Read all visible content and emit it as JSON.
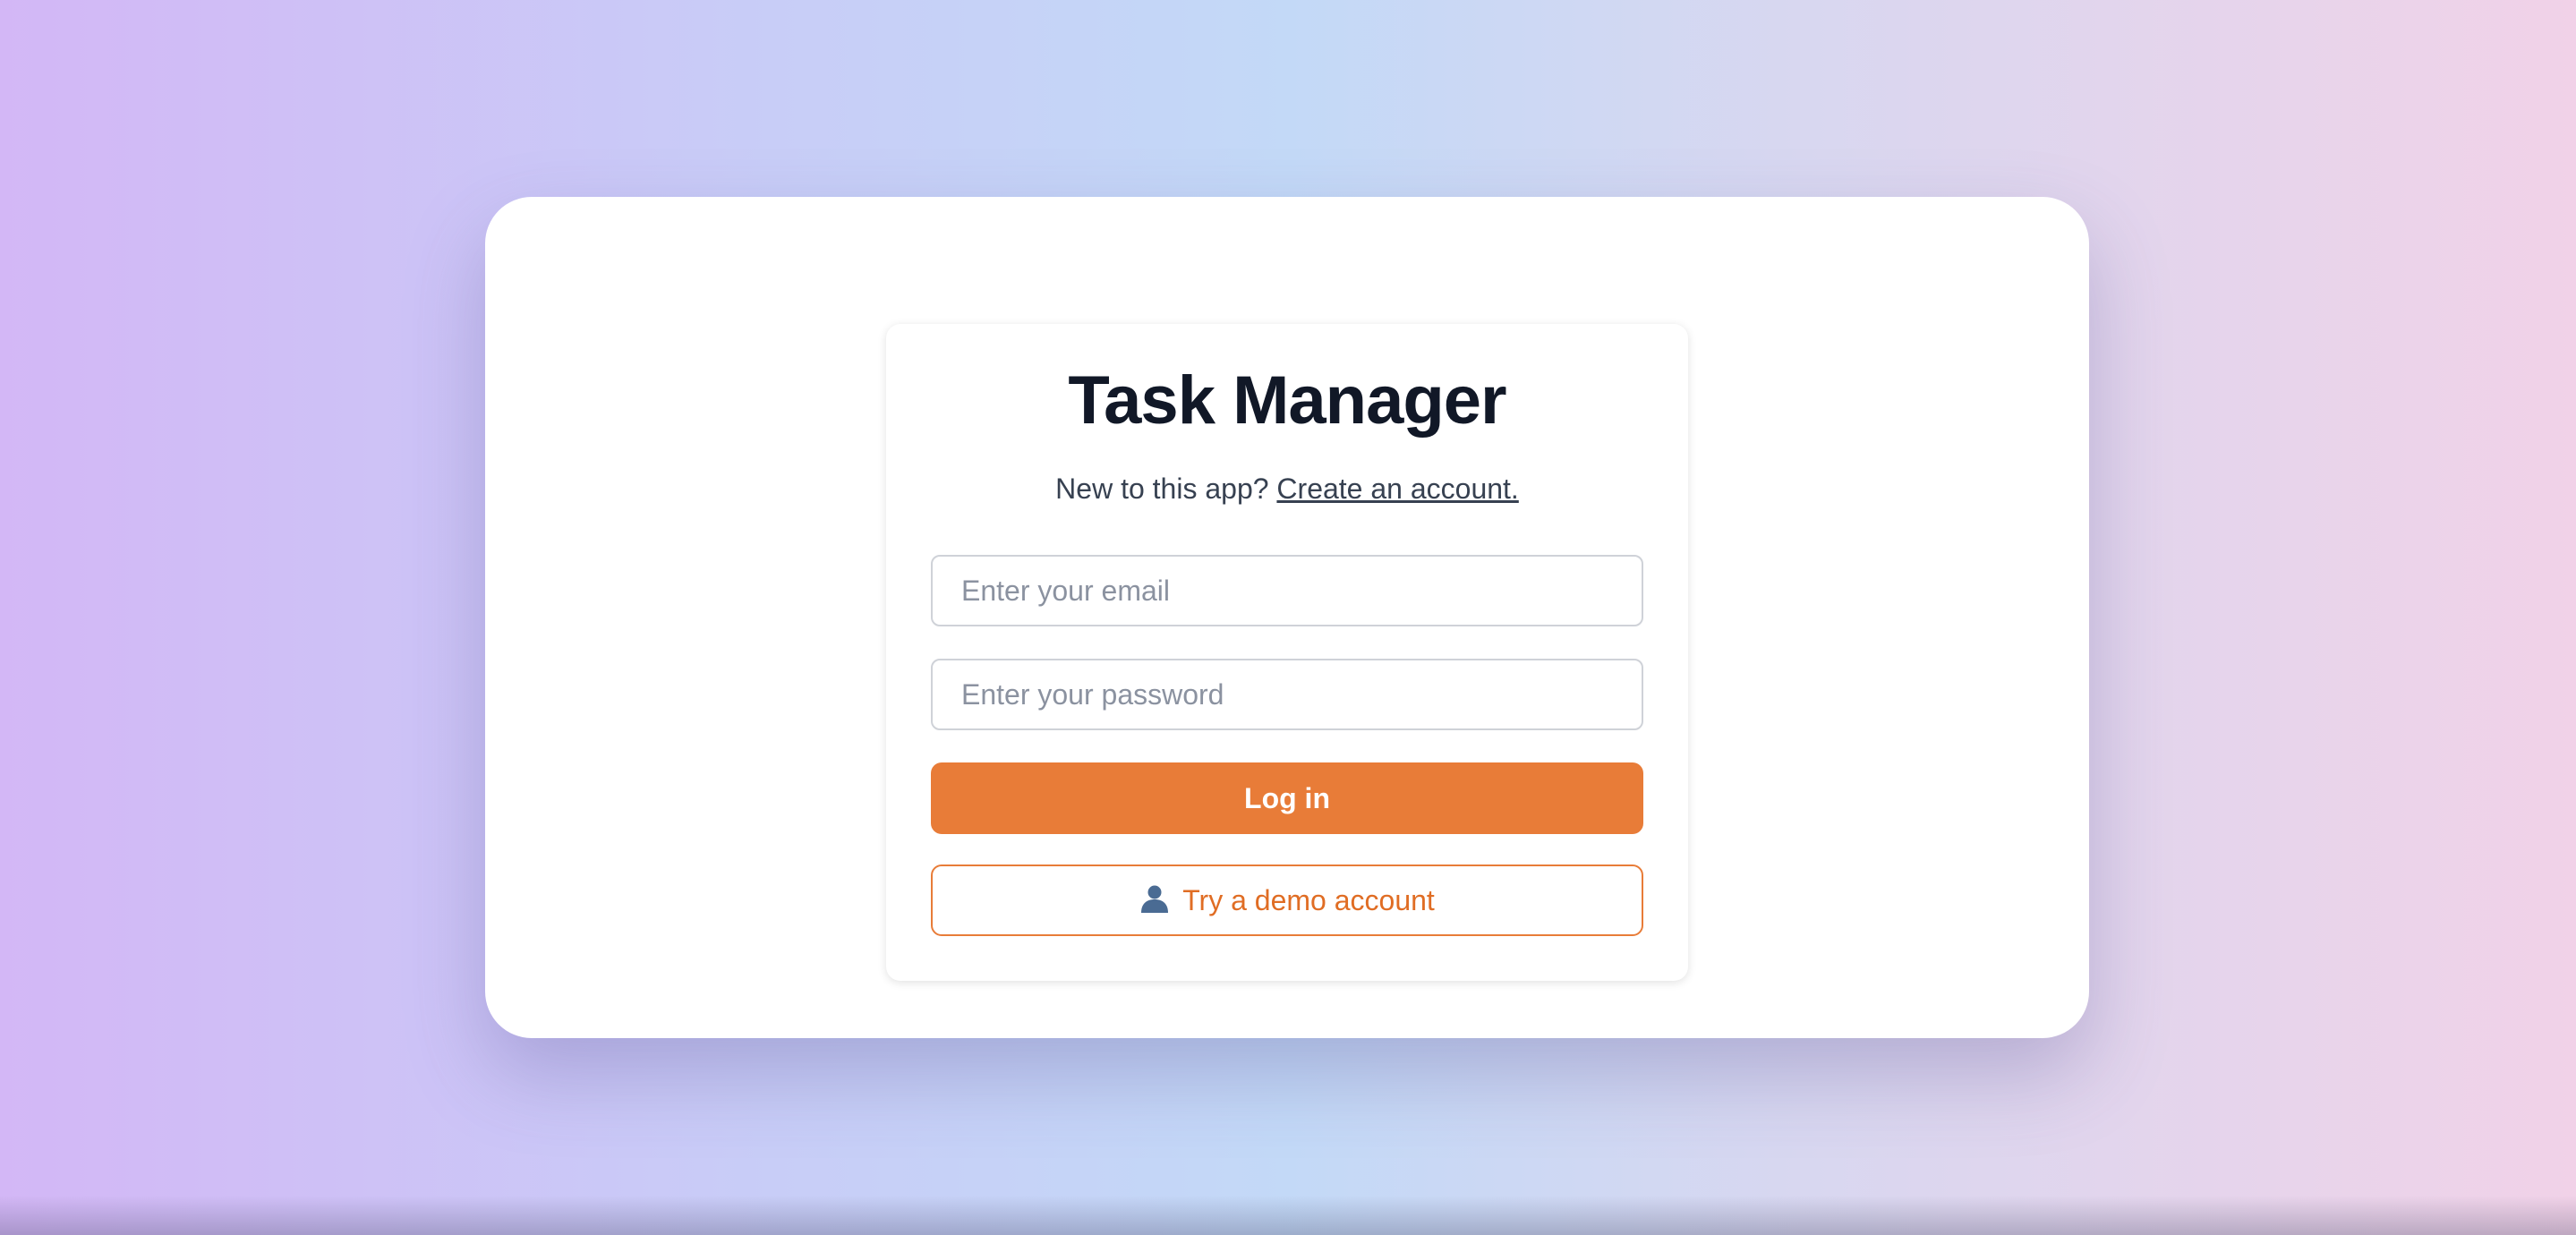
{
  "app": {
    "title": "Task Manager",
    "subtitle_prefix": "New to this app? ",
    "create_account_link": "Create an account."
  },
  "form": {
    "email_placeholder": "Enter your email",
    "password_placeholder": "Enter your password",
    "login_label": "Log in",
    "demo_label": "Try a demo account",
    "demo_icon": "user-silhouette-icon"
  },
  "colors": {
    "accent": "#e87c38",
    "title_text": "#111827",
    "background_left": "#d3b7f6",
    "background_center": "#c3d9f7",
    "background_right": "#f1d2e8"
  }
}
